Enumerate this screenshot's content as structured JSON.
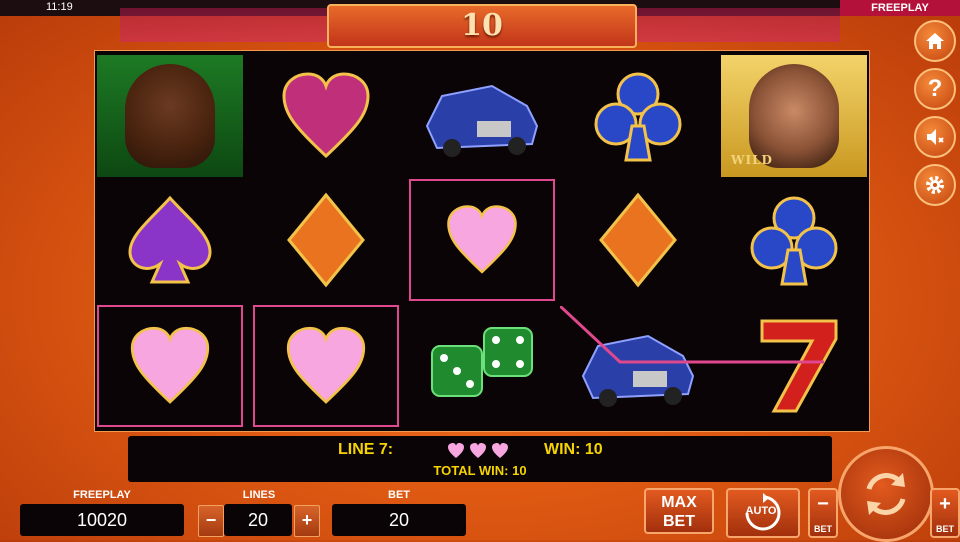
{
  "status_bar": {
    "time": "11:19",
    "mode": "FREEPLAY"
  },
  "top_win": "10",
  "reels": [
    [
      "lady-portrait",
      "spade",
      "heart"
    ],
    [
      "heart",
      "diamond",
      "heart"
    ],
    [
      "car",
      "heart",
      "dice"
    ],
    [
      "club",
      "diamond",
      "car"
    ],
    [
      "man-wild",
      "club",
      "seven"
    ]
  ],
  "wild_label": "WILD",
  "info": {
    "line_label": "LINE 7:",
    "win_label": "WIN: 10",
    "total_label": "TOTAL WIN: 10"
  },
  "footer": {
    "freeplay_label": "FREEPLAY",
    "freeplay_value": "10020",
    "lines_label": "LINES",
    "lines_value": "20",
    "bet_label": "BET",
    "bet_value": "20",
    "minus": "−",
    "plus": "+",
    "maxbet_line1": "MAX",
    "maxbet_line2": "BET",
    "auto": "AUTO",
    "bet_minus_label": "BET",
    "bet_plus_label": "BET"
  },
  "colors": {
    "heart": "#f7a6e0",
    "spade": "#8a34c8",
    "diamond": "#e9731f",
    "club": "#2848c8",
    "highlight": "#e0488e"
  }
}
